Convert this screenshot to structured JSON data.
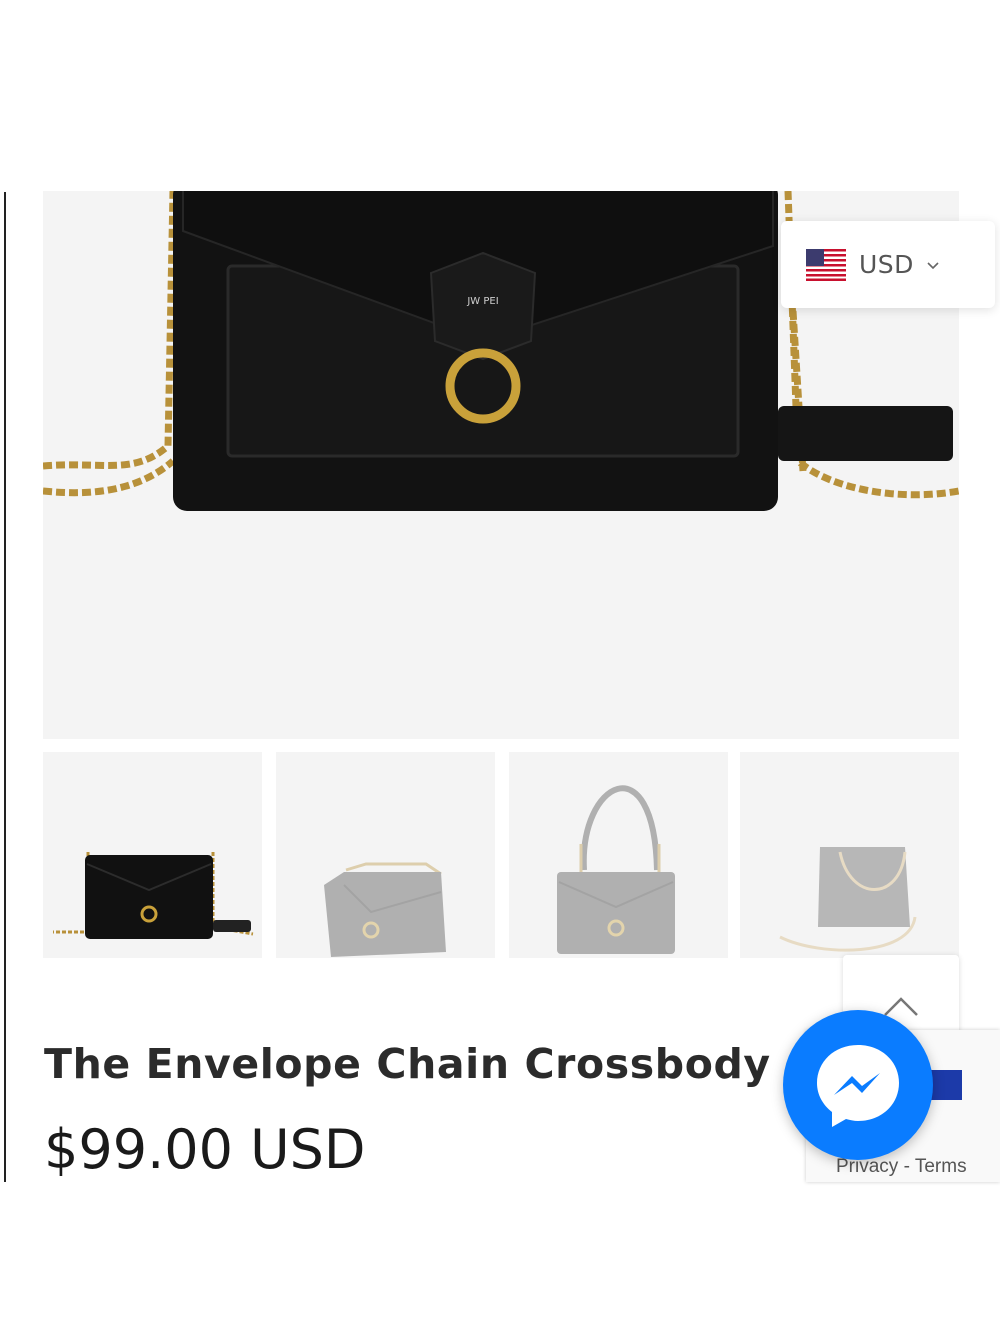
{
  "currency": {
    "code": "USD",
    "flag_icon": "us-flag-icon",
    "chevron_icon": "chevron-down-icon"
  },
  "product": {
    "logo_text": "JW PEI",
    "title": "The Envelope Chain Crossbody -",
    "price": "$99.00 USD"
  },
  "thumbnails": [
    {
      "icon": "bag-front-black",
      "selected": true
    },
    {
      "icon": "bag-angle",
      "selected": false
    },
    {
      "icon": "bag-shoulder-strap",
      "selected": false
    },
    {
      "icon": "bag-side-chain",
      "selected": false
    }
  ],
  "recaptcha": {
    "privacy": "Privacy",
    "separator": "-",
    "terms": "Terms"
  },
  "colors": {
    "messenger_blue": "#0a7cff",
    "gold": "#c9a13a",
    "bag_black": "#111111"
  }
}
